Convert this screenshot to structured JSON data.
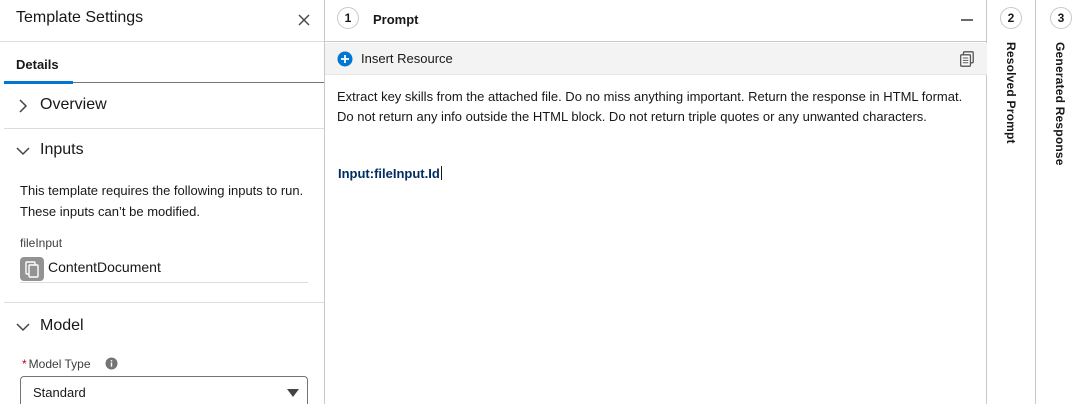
{
  "left_panel": {
    "title": "Template Settings",
    "tab_details": "Details",
    "sections": {
      "overview": "Overview",
      "inputs": "Inputs",
      "model": "Model"
    },
    "inputs_description": "This template requires the following inputs to run. These inputs can’t be modified.",
    "input_field_label": "fileInput",
    "input_field_value": "ContentDocument",
    "model_type_label": "Model Type",
    "model_type_value": "Standard"
  },
  "prompt_panel": {
    "step": "1",
    "title": "Prompt",
    "insert_resource": "Insert Resource",
    "prompt_text": "Extract key skills from the attached file. Do no miss anything important. Return the response in HTML format. Do not return any info outside the HTML block. Do not return triple quotes or any unwanted characters.",
    "merge_field": "Input:fileInput.Id"
  },
  "collapsed_panels": [
    {
      "step": "2",
      "label": "Resolved Prompt"
    },
    {
      "step": "3",
      "label": "Generated Response"
    }
  ],
  "colors": {
    "accent": "#0176d3",
    "merge_field": "#032d60",
    "required": "#ba0517"
  },
  "icons": [
    "close-icon",
    "chevron-right-icon",
    "chevron-down-icon",
    "document-icon",
    "info-icon",
    "caret-down-icon",
    "minimize-icon",
    "plus-circle-icon",
    "copy-icon"
  ]
}
